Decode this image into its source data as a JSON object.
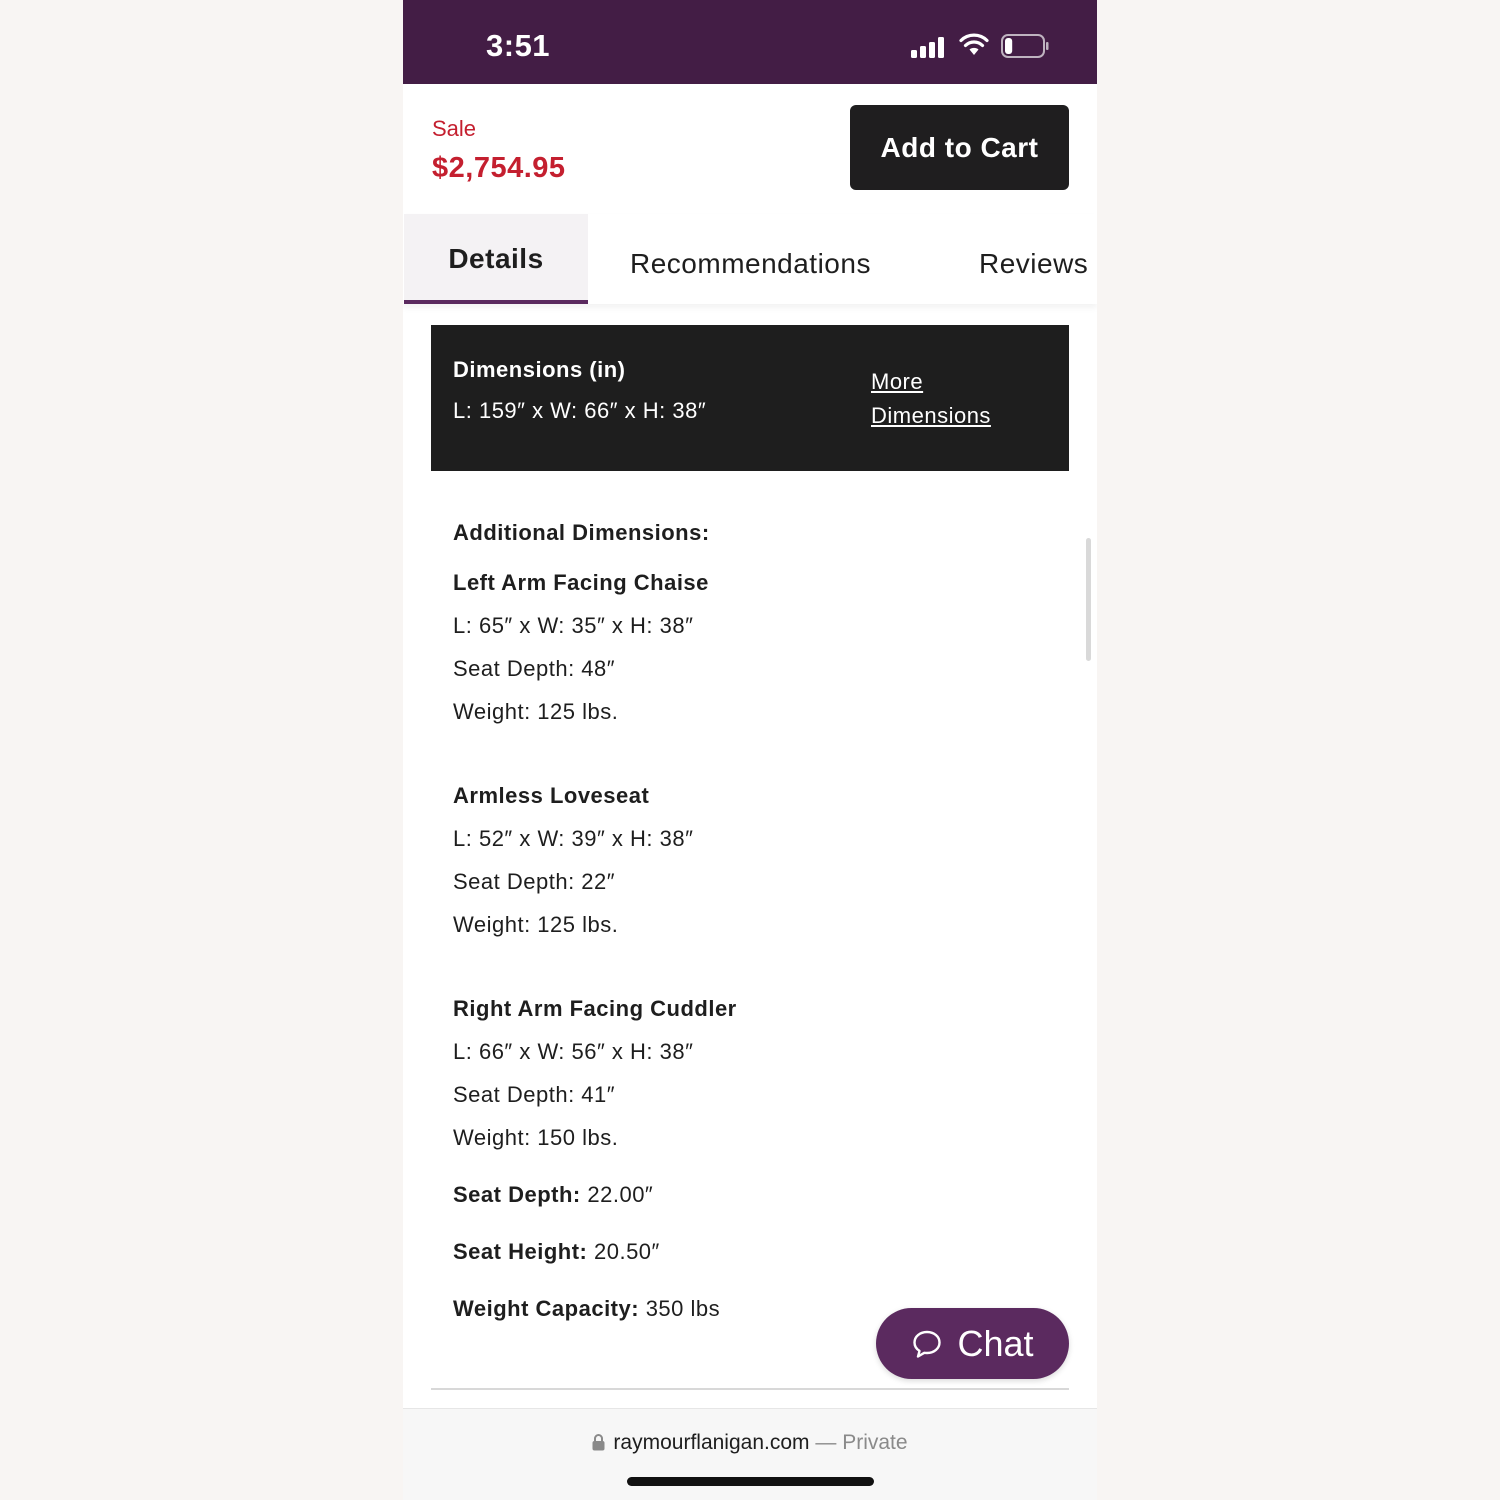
{
  "status_bar": {
    "time": "3:51",
    "background": "#431d45",
    "battery_level": 0.2
  },
  "price": {
    "sale_label": "Sale",
    "sale_price": "$2,754.95",
    "color": "#c41f2f"
  },
  "cart_button": {
    "label": "Add to Cart"
  },
  "tabs": [
    {
      "label": "Details",
      "active": true
    },
    {
      "label": "Recommendations",
      "active": false
    },
    {
      "label": "Reviews",
      "active": false
    }
  ],
  "dimensions": {
    "title": "Dimensions (in)",
    "value": "L: 159″ x W: 66″ x H: 38″",
    "link": "More Dimensions"
  },
  "additional": {
    "heading": "Additional Dimensions:",
    "pieces": [
      {
        "name": "Left Arm Facing Chaise",
        "dims": "L: 65″ x W: 35″ x H: 38″",
        "seat_depth": "Seat Depth: 48″",
        "weight": "Weight: 125 lbs."
      },
      {
        "name": "Armless Loveseat",
        "dims": "L: 52″ x W: 39″ x H: 38″",
        "seat_depth": "Seat Depth: 22″",
        "weight": "Weight: 125 lbs."
      },
      {
        "name": "Right Arm Facing Cuddler",
        "dims": "L: 66″ x W: 56″ x H: 38″",
        "seat_depth": "Seat Depth: 41″",
        "weight": "Weight: 150 lbs."
      }
    ]
  },
  "specs": [
    {
      "label": "Seat Depth:",
      "value": "22.00″"
    },
    {
      "label": "Seat Height:",
      "value": "20.50″"
    },
    {
      "label": "Weight Capacity:",
      "value": "350 lbs"
    }
  ],
  "chat": {
    "label": "Chat",
    "icon": "chat-bubble-icon",
    "color": "#5b2a5f"
  },
  "url_bar": {
    "domain": "raymourflanigan.com",
    "suffix": "— Private"
  }
}
